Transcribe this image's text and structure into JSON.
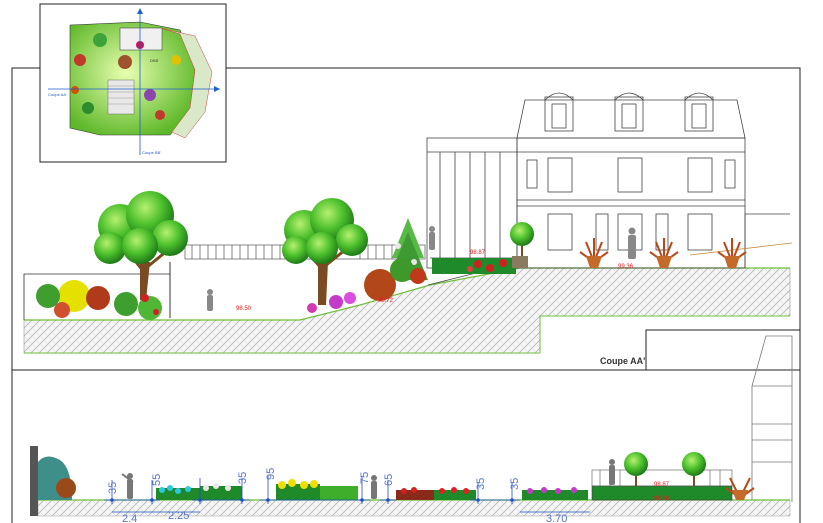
{
  "section_aa": {
    "title": "Coupe AA'",
    "elevations": [
      "98.50",
      "98.72",
      "98.87",
      "99.36"
    ]
  },
  "section_bb": {
    "elevations": [
      "98.87",
      "98.98"
    ],
    "dimensions_top": [
      "35",
      "55",
      "35",
      "95",
      "75",
      "65",
      "35",
      "35"
    ],
    "dimensions_bottom": [
      "2.4",
      "2.25",
      "3.70"
    ]
  },
  "plan_inset": {
    "label_aa": "Coupe AA'",
    "label_bb": "Coupe BB'",
    "stair_label": "DKB"
  },
  "colors": {
    "frame": "#222222",
    "ground_line": "#6fbf3a",
    "hatch": "#b0b0b0",
    "elevation_text": "#e02020",
    "dimension": "#1e4fc8",
    "foliage": "#3fae2a",
    "trunk": "#7a4a22"
  }
}
